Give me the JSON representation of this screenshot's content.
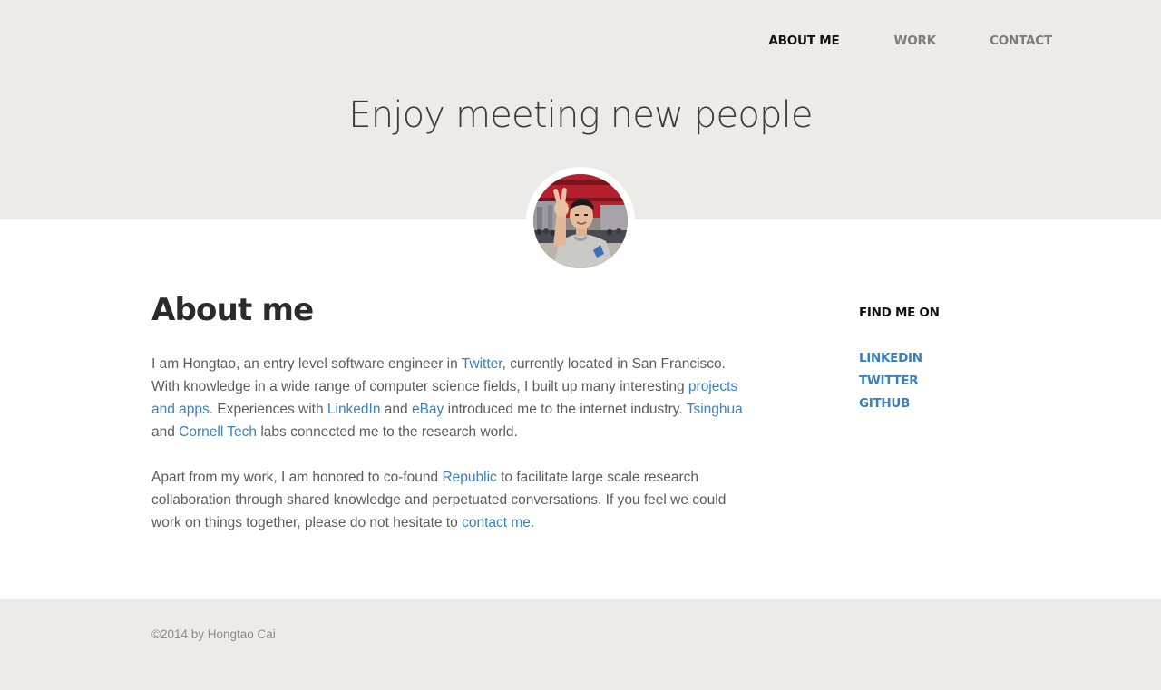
{
  "nav": {
    "about": "ABOUT ME",
    "work": "WORK",
    "contact": "CONTACT"
  },
  "hero": {
    "tagline": "Enjoy meeting new people"
  },
  "about": {
    "heading": "About me",
    "p1": {
      "t1": "I am Hongtao, an entry level software engineer in ",
      "link_twitter": "Twitter",
      "t2": ", currently located in San Francisco. With knowledge in a wide range of computer science fields, I built up many interesting ",
      "link_projects": "projects and apps",
      "t3": ". Experiences with ",
      "link_linkedin": "LinkedIn",
      "t4": " and ",
      "link_ebay": "eBay",
      "t5": " introduced me to the internet industry. ",
      "link_tsinghua": "Tsinghua",
      "t6": " and ",
      "link_cornell": "Cornell Tech",
      "t7": " labs connected me to the research world."
    },
    "p2": {
      "t1": "Apart from my work, I am honored to co-found ",
      "link_republic": "Republic",
      "t2": " to facilitate large scale research collaboration through shared knowledge and perpetuated conversations. If you feel we could work on things together, please do not hesitate to ",
      "link_contact": "contact me",
      "t3": "."
    }
  },
  "sidebar": {
    "heading": "FIND ME ON",
    "links": [
      "LINKEDIN",
      "TWITTER",
      "GITHUB"
    ]
  },
  "footer": {
    "copyright": "©2014 by Hongtao Cai"
  },
  "colors": {
    "header_bg": "#edebe9",
    "link": "#3a7fc1",
    "text": "#5c5c5c",
    "heading": "#2b2b2b"
  }
}
